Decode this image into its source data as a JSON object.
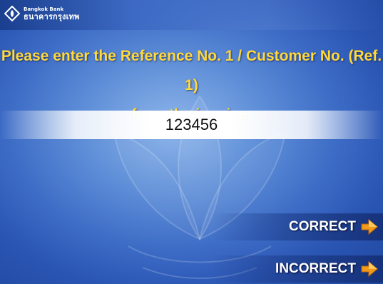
{
  "header": {
    "logo_icon": "bangkok-bank-logo-icon",
    "bank_name_en": "Bangkok Bank",
    "bank_name_th": "ธนาคารกรุงเทพ"
  },
  "prompt": {
    "line1": "Please enter the Reference No. 1 / Customer No. (Ref. 1)",
    "line2": "from the invoice."
  },
  "input": {
    "value": "123456"
  },
  "options": {
    "correct_label": "CORRECT",
    "incorrect_label": "INCORRECT",
    "arrow_icon": "orange-arrow-right-icon"
  },
  "colors": {
    "prompt_text": "#ffd83a",
    "arrow": "#f29a1c",
    "background": "#3d6cc6"
  }
}
